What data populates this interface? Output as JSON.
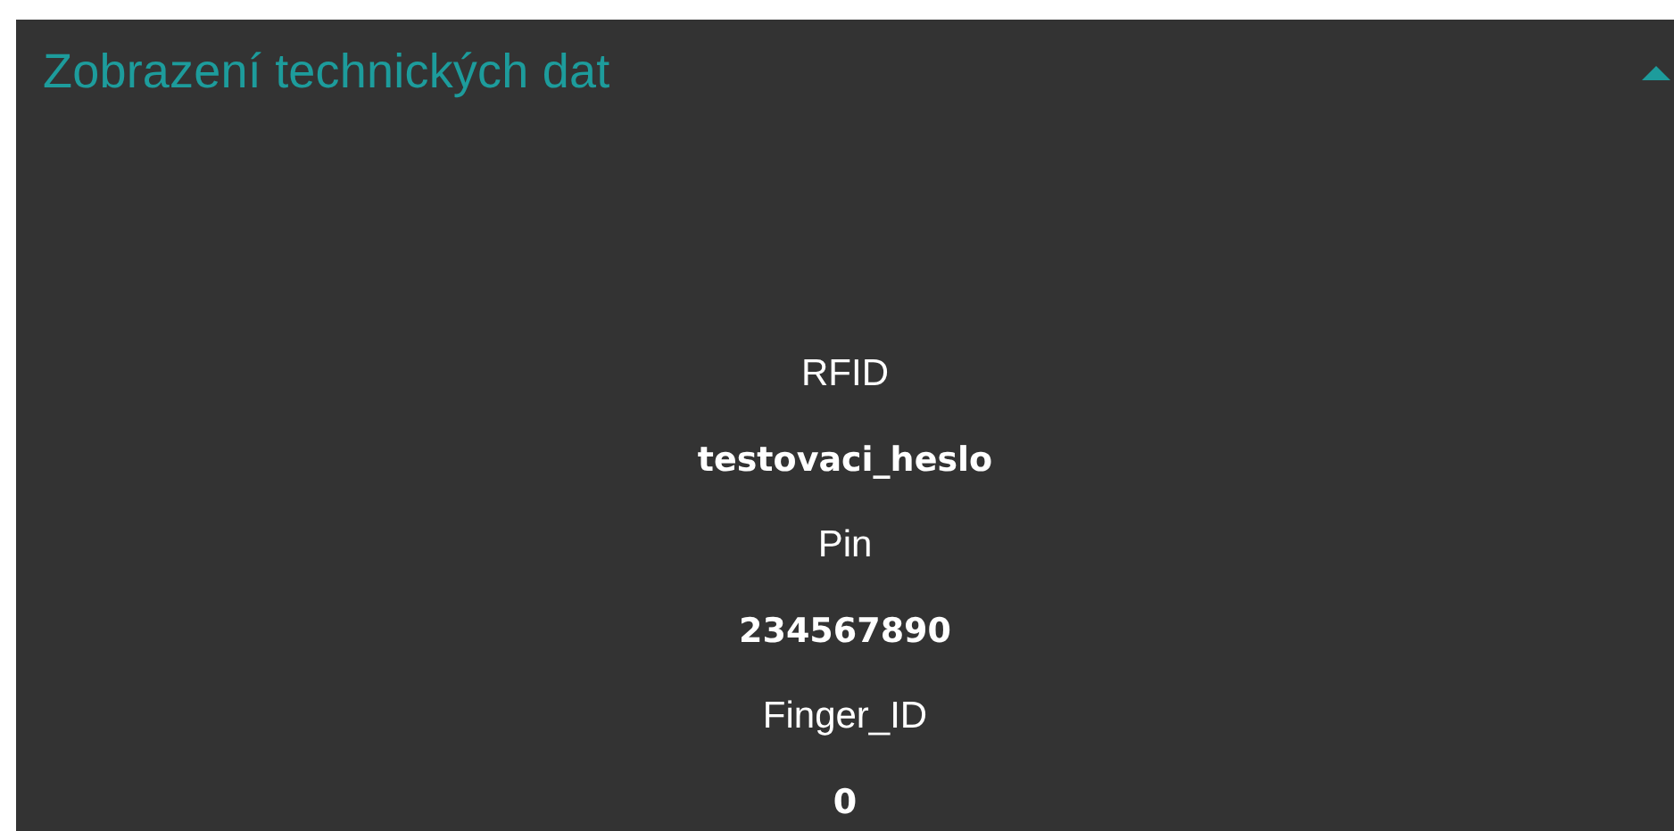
{
  "panel": {
    "title": "Zobrazení technických dat",
    "expanded": true,
    "fields": [
      {
        "label": "RFID",
        "value": "testovaci_heslo"
      },
      {
        "label": "Pin",
        "value": "234567890"
      },
      {
        "label": "Finger_ID",
        "value": "0"
      }
    ]
  }
}
